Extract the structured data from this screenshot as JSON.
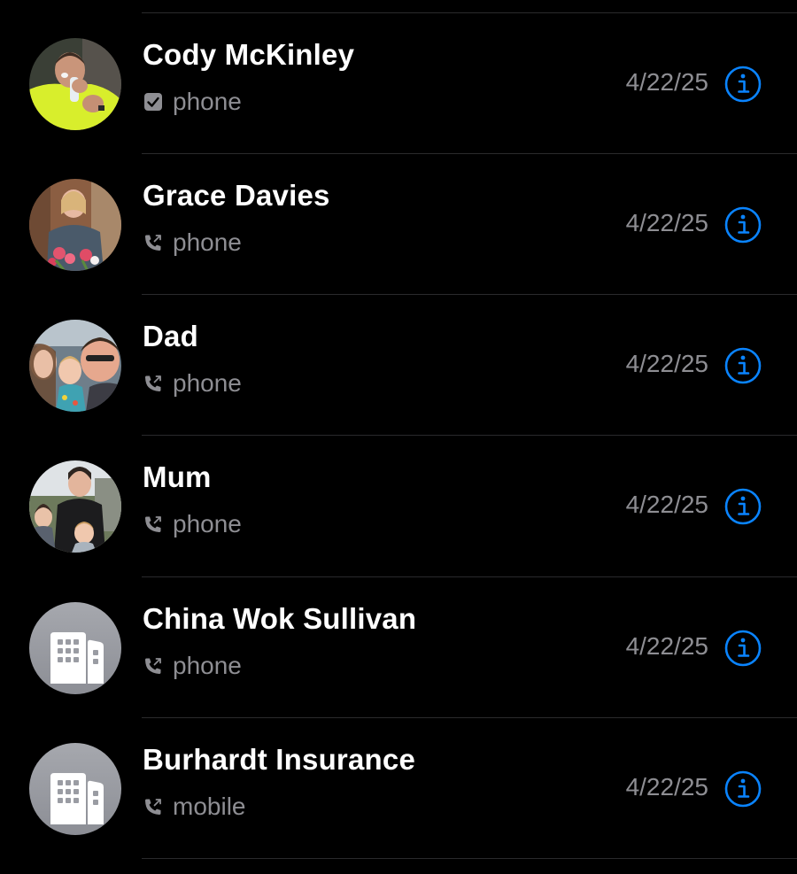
{
  "colors": {
    "background": "#000000",
    "name_text": "#ffffff",
    "secondary_text": "#8e8e93",
    "accent": "#0a84ff",
    "separator": "#2a2a2c",
    "business_avatar_bg": "#9a9ca3"
  },
  "calls": [
    {
      "name": "Cody McKinley",
      "type": "phone",
      "date": "4/22/25",
      "call_icon": "checkbox-icon",
      "avatar": "photo"
    },
    {
      "name": "Grace Davies",
      "type": "phone",
      "date": "4/22/25",
      "call_icon": "outgoing-call-icon",
      "avatar": "photo"
    },
    {
      "name": "Dad",
      "type": "phone",
      "date": "4/22/25",
      "call_icon": "outgoing-call-icon",
      "avatar": "photo"
    },
    {
      "name": "Mum",
      "type": "phone",
      "date": "4/22/25",
      "call_icon": "outgoing-call-icon",
      "avatar": "photo"
    },
    {
      "name": "China Wok Sullivan",
      "type": "phone",
      "date": "4/22/25",
      "call_icon": "outgoing-call-icon",
      "avatar": "business-icon"
    },
    {
      "name": "Burhardt Insurance",
      "type": "mobile",
      "date": "4/22/25",
      "call_icon": "outgoing-call-icon",
      "avatar": "business-icon"
    }
  ],
  "row_action": {
    "icon": "info-icon"
  }
}
